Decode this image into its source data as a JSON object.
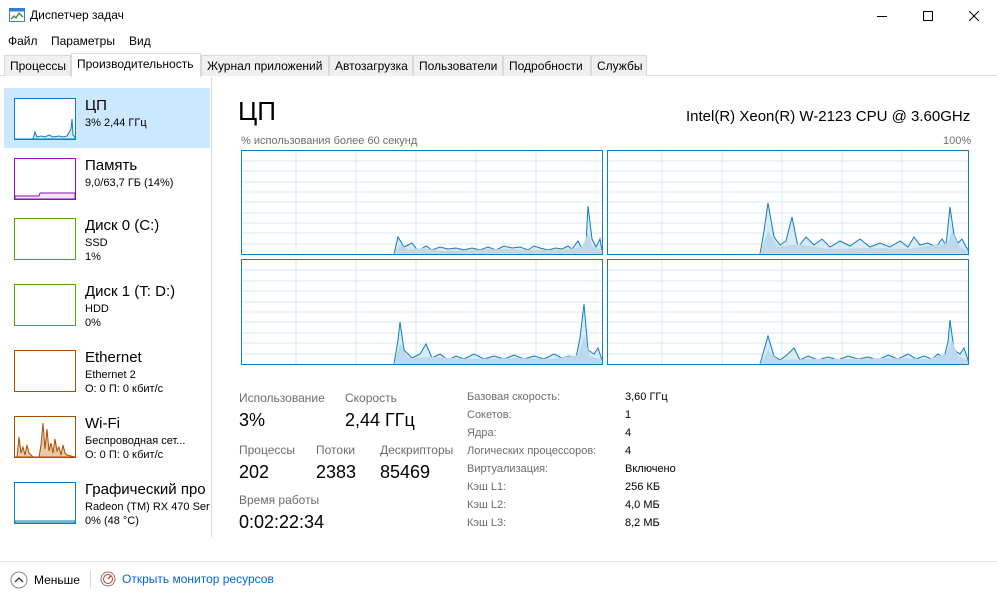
{
  "window": {
    "title": "Диспетчер задач",
    "controls": [
      "minimize-icon",
      "maximize-icon",
      "close-icon"
    ]
  },
  "menu": [
    {
      "label": "Файл"
    },
    {
      "label": "Параметры"
    },
    {
      "label": "Вид"
    }
  ],
  "tabs": [
    {
      "label": "Процессы",
      "active": false
    },
    {
      "label": "Производительность",
      "active": true
    },
    {
      "label": "Журнал приложений",
      "active": false
    },
    {
      "label": "Автозагрузка",
      "active": false
    },
    {
      "label": "Пользователи",
      "active": false
    },
    {
      "label": "Подробности",
      "active": false
    },
    {
      "label": "Службы",
      "active": false
    }
  ],
  "sidebar": {
    "items": [
      {
        "title": "ЦП",
        "line1": "3% 2,44 ГГц",
        "line2": "",
        "color": "#117dbb",
        "selected": true
      },
      {
        "title": "Память",
        "line1": "9,0/63,7 ГБ (14%)",
        "line2": "",
        "color": "#8b12ae",
        "selected": false
      },
      {
        "title": "Диск 0 (C:)",
        "line1": "SSD",
        "line2": "1%",
        "color": "#4da60c",
        "selected": false
      },
      {
        "title": "Диск 1 (T: D:)",
        "line1": "HDD",
        "line2": "0%",
        "color": "#4da60c",
        "selected": false
      },
      {
        "title": "Ethernet",
        "line1": "Ethernet 2",
        "line2": "О: 0 П: 0 кбит/с",
        "color": "#a74f01",
        "selected": false
      },
      {
        "title": "Wi-Fi",
        "line1": "Беспроводная сет...",
        "line2": "О: 0 П: 0 кбит/с",
        "color": "#a74f01",
        "selected": false
      },
      {
        "title": "Графический про",
        "line1": "Radeon (TM) RX 470 Ser",
        "line2": "0% (48 °C)",
        "color": "#117dbb",
        "selected": false
      }
    ]
  },
  "main": {
    "title": "ЦП",
    "cpu_name": "Intel(R) Xeon(R) W-2123 CPU @ 3.60GHz",
    "axis_label": "% использования более 60 секунд",
    "axis_max": "100%",
    "graph_color": "#117dbb",
    "stats": {
      "usage_label": "Использование",
      "usage_value": "3%",
      "speed_label": "Скорость",
      "speed_value": "2,44 ГГц",
      "processes_label": "Процессы",
      "processes_value": "202",
      "threads_label": "Потоки",
      "threads_value": "2383",
      "handles_label": "Дескрипторы",
      "handles_value": "85469",
      "uptime_label": "Время работы",
      "uptime_value": "0:02:22:34"
    },
    "specs": [
      {
        "label": "Базовая скорость:",
        "value": "3,60 ГГц"
      },
      {
        "label": "Сокетов:",
        "value": "1"
      },
      {
        "label": "Ядра:",
        "value": "4"
      },
      {
        "label": "Логических процессоров:",
        "value": "4"
      },
      {
        "label": "Виртуализация:",
        "value": "Включено"
      },
      {
        "label": "Кэш L1:",
        "value": "256 КБ"
      },
      {
        "label": "Кэш L2:",
        "value": "4,0 МБ"
      },
      {
        "label": "Кэш L3:",
        "value": "8,2 МБ"
      }
    ]
  },
  "footer": {
    "less_label": "Меньше",
    "monitor_link": "Открыть монитор ресурсов"
  }
}
